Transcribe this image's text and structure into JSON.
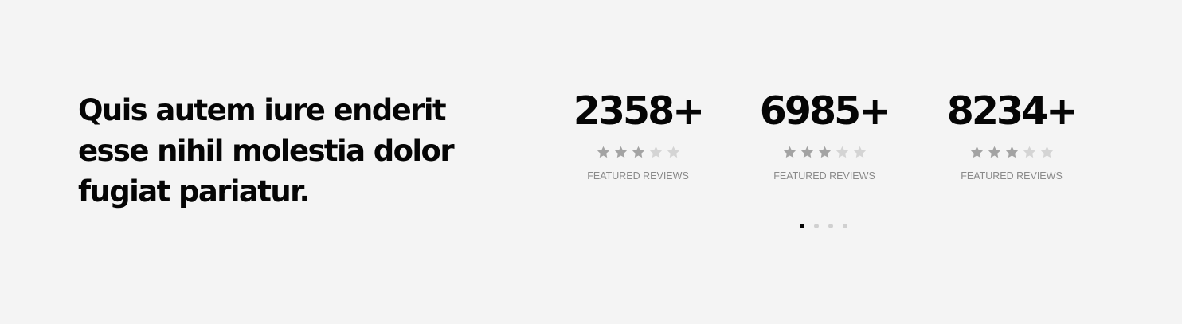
{
  "section": {
    "headline": "Quis autem iure enderit esse nihil molestia dolor fugiat pariatur."
  },
  "stats": [
    {
      "number": "2358+",
      "rating": 3,
      "max_rating": 5,
      "label": "FEATURED REVIEWS"
    },
    {
      "number": "6985+",
      "rating": 3,
      "max_rating": 5,
      "label": "FEATURED REVIEWS"
    },
    {
      "number": "8234+",
      "rating": 3,
      "max_rating": 5,
      "label": "FEATURED REVIEWS"
    }
  ],
  "pagination": {
    "total": 4,
    "active_index": 0
  },
  "colors": {
    "background": "#f4f4f4",
    "text": "#050505",
    "star_filled": "#a3a3a3",
    "star_empty": "#d4d4d4",
    "label": "#8a8a8a",
    "dot_active": "#050505",
    "dot_inactive": "#d0d0d0"
  },
  "icons": {
    "rating_star": "star-icon"
  }
}
